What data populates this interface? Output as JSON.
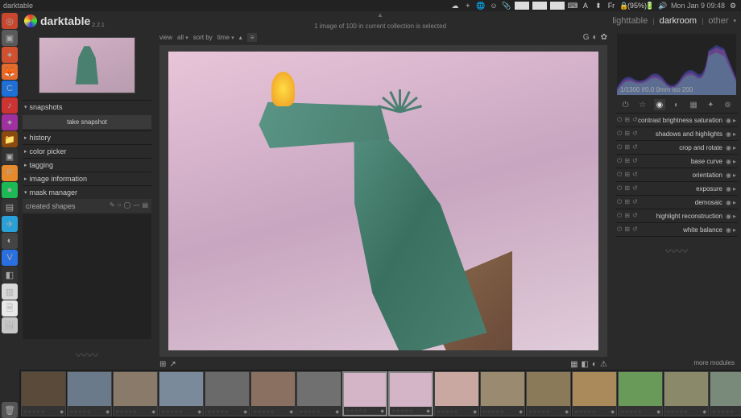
{
  "sysbar": {
    "title": "darktable",
    "battery": "(95%)",
    "clock": "Mon Jan  9 09:48",
    "tray_icons": [
      "cloud",
      "plus",
      "globe",
      "smile",
      "clip",
      "A",
      "net",
      "vol",
      "lock"
    ]
  },
  "dock": [
    {
      "color": "#c8472e",
      "glyph": "◎"
    },
    {
      "color": "#5a5a5a",
      "glyph": "▣"
    },
    {
      "color": "#d05030",
      "glyph": "✦"
    },
    {
      "color": "#e66a2c",
      "glyph": "🦊"
    },
    {
      "color": "#1e6fd8",
      "glyph": "C"
    },
    {
      "color": "#cc3333",
      "glyph": "♪"
    },
    {
      "color": "#a030a0",
      "glyph": "✦"
    },
    {
      "color": "#8a4a10",
      "glyph": "📁"
    },
    {
      "color": "#333",
      "glyph": "▣"
    },
    {
      "color": "#e68a2c",
      "glyph": "P"
    },
    {
      "color": "#1db954",
      "glyph": "●"
    },
    {
      "color": "#333",
      "glyph": "▤"
    },
    {
      "color": "#2aa0d8",
      "glyph": "✈"
    },
    {
      "color": "#444",
      "glyph": "◐"
    },
    {
      "color": "#2a70e0",
      "glyph": "V"
    },
    {
      "color": "#333",
      "glyph": "◧"
    },
    {
      "color": "#d8d8d8",
      "glyph": "▥"
    },
    {
      "color": "#e8e8e8",
      "glyph": "🗎"
    },
    {
      "color": "#c8c8c8",
      "glyph": "🖼"
    }
  ],
  "app": {
    "name": "darktable",
    "version": "2.2.1",
    "status": "1 image of 100 in current collection is selected",
    "tabs": {
      "lighttable": "lighttable",
      "darkroom": "darkroom",
      "other": "other",
      "active": "darkroom"
    }
  },
  "left": {
    "snapshots": {
      "title": "snapshots",
      "button": "take snapshot"
    },
    "history": {
      "title": "history"
    },
    "color_picker": {
      "title": "color picker"
    },
    "tagging": {
      "title": "tagging"
    },
    "image_info": {
      "title": "image information"
    },
    "mask_manager": {
      "title": "mask manager",
      "created": "created shapes"
    }
  },
  "center": {
    "view_label": "view",
    "view_value": "all",
    "sort_label": "sort by",
    "sort_value": "time"
  },
  "right": {
    "histo_label": "1/1300 f/0.0 0mm iso 200",
    "modules": [
      {
        "name": "contrast brightness saturation"
      },
      {
        "name": "shadows and highlights"
      },
      {
        "name": "crop and rotate"
      },
      {
        "name": "base curve"
      },
      {
        "name": "orientation"
      },
      {
        "name": "exposure"
      },
      {
        "name": "demosaic"
      },
      {
        "name": "highlight reconstruction"
      },
      {
        "name": "white balance"
      }
    ],
    "more": "more modules"
  },
  "filmstrip": {
    "stars": "☆☆☆☆☆",
    "thumbs": [
      {
        "bg": "#5a4a3a"
      },
      {
        "bg": "#6a7a8a"
      },
      {
        "bg": "#8a7a6a"
      },
      {
        "bg": "#7a8a9a"
      },
      {
        "bg": "#6a6a6a"
      },
      {
        "bg": "#8a7060"
      },
      {
        "bg": "#707070"
      },
      {
        "bg": "#d4b5c8",
        "sel": true
      },
      {
        "bg": "#d4b5c8",
        "sel": true
      },
      {
        "bg": "#c8a8a0"
      },
      {
        "bg": "#9a8a70"
      },
      {
        "bg": "#8a7a5a"
      },
      {
        "bg": "#aa8a5a"
      },
      {
        "bg": "#6a9a5a"
      },
      {
        "bg": "#8a8a6a"
      },
      {
        "bg": "#7a8a7a"
      },
      {
        "bg": "#6a6a5a"
      }
    ]
  }
}
